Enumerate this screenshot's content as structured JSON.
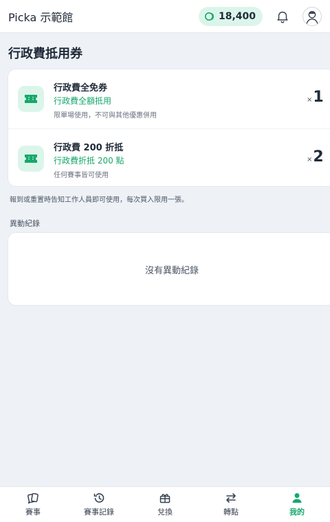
{
  "header": {
    "app_title": "Picka 示範館",
    "points": "18,400",
    "points_icon": "coin-icon",
    "notification_icon": "bell-icon",
    "avatar_icon": "avatar-icon"
  },
  "page": {
    "title": "行政費抵用券"
  },
  "coupons": [
    {
      "name": "行政費全免券",
      "value": "行政費全額抵用",
      "note": "限單場使用，不可與其他優惠併用",
      "qty_prefix": "×",
      "qty": "1",
      "icon": "ticket-icon"
    },
    {
      "name": "行政費 200 折抵",
      "value": "行政費折抵 200 點",
      "note": "任何賽事皆可使用",
      "qty_prefix": "×",
      "qty": "2",
      "icon": "ticket-icon"
    }
  ],
  "notice": "報到或重置時告知工作人員即可使用，每次買入限用一張。",
  "history": {
    "label": "異動紀錄",
    "empty_text": "沒有異動紀錄"
  },
  "nav": [
    {
      "label": "賽事",
      "icon": "cards-icon",
      "active": false
    },
    {
      "label": "賽事記錄",
      "icon": "history-icon",
      "active": false
    },
    {
      "label": "兌換",
      "icon": "gift-icon",
      "active": false
    },
    {
      "label": "轉點",
      "icon": "transfer-icon",
      "active": false
    },
    {
      "label": "我的",
      "icon": "person-icon",
      "active": true
    }
  ],
  "colors": {
    "accent": "#16a86b",
    "accent_light": "#dcf5ea",
    "background": "#eef2f7",
    "text_dark": "#1f2d3a"
  }
}
